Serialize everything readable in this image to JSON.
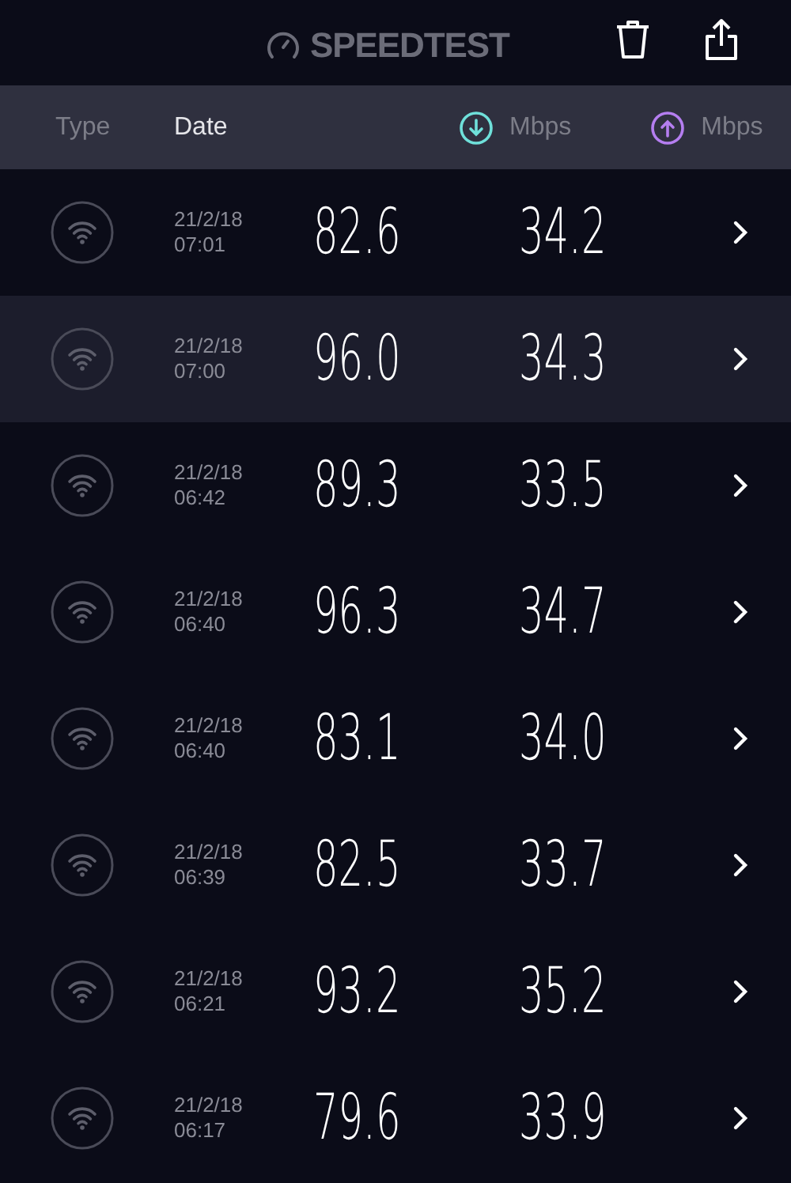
{
  "header": {
    "title": "SPEEDTEST"
  },
  "columns": [
    {
      "label": "Type",
      "selected": false,
      "kind": "text"
    },
    {
      "label": "Date",
      "selected": true,
      "kind": "text"
    },
    {
      "label": "Mbps",
      "selected": false,
      "kind": "download"
    },
    {
      "label": "Mbps",
      "selected": false,
      "kind": "upload"
    }
  ],
  "rows": [
    {
      "date": "21/2/18",
      "time": "07:01",
      "download": "82.6",
      "upload": "34.2",
      "selected": false
    },
    {
      "date": "21/2/18",
      "time": "07:00",
      "download": "96.0",
      "upload": "34.3",
      "selected": true
    },
    {
      "date": "21/2/18",
      "time": "06:42",
      "download": "89.3",
      "upload": "33.5",
      "selected": false
    },
    {
      "date": "21/2/18",
      "time": "06:40",
      "download": "96.3",
      "upload": "34.7",
      "selected": false
    },
    {
      "date": "21/2/18",
      "time": "06:40",
      "download": "83.1",
      "upload": "34.0",
      "selected": false
    },
    {
      "date": "21/2/18",
      "time": "06:39",
      "download": "82.5",
      "upload": "33.7",
      "selected": false
    },
    {
      "date": "21/2/18",
      "time": "06:21",
      "download": "93.2",
      "upload": "35.2",
      "selected": false
    },
    {
      "date": "21/2/18",
      "time": "06:17",
      "download": "79.6",
      "upload": "33.9",
      "selected": false
    }
  ]
}
